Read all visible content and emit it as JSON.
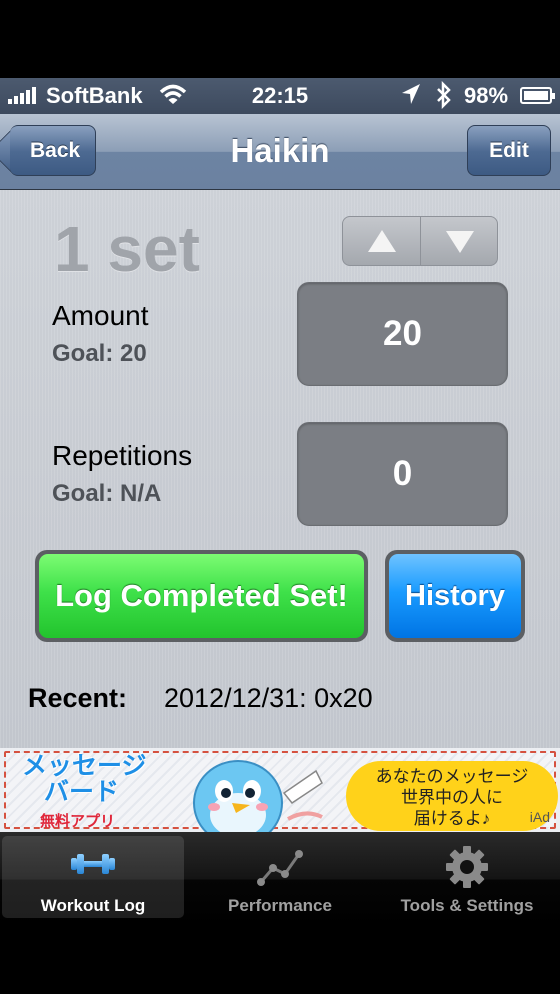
{
  "status_bar": {
    "carrier": "SoftBank",
    "time": "22:15",
    "battery": "98%"
  },
  "nav": {
    "back_label": "Back",
    "title": "Haikin",
    "edit_label": "Edit"
  },
  "workout": {
    "set_label": "1 set",
    "amount_label": "Amount",
    "amount_goal": "Goal: 20",
    "amount_value": "20",
    "reps_label": "Repetitions",
    "reps_goal": "Goal: N/A",
    "reps_value": "0",
    "log_button": "Log Completed Set!",
    "history_button": "History",
    "recent_label": "Recent:",
    "recent_value": "2012/12/31: 0x20"
  },
  "ad": {
    "title_line1": "メッセージ",
    "title_line2": "バード",
    "free_label": "無料アプリ",
    "bubble_line1": "あなたのメッセージ",
    "bubble_line2": "世界中の人に",
    "bubble_line3": "届けるよ♪",
    "iad": "iAd"
  },
  "tabs": [
    {
      "label": "Workout Log",
      "icon": "dumbbell-icon",
      "active": true
    },
    {
      "label": "Performance",
      "icon": "graph-icon",
      "active": false
    },
    {
      "label": "Tools & Settings",
      "icon": "gear-icon",
      "active": false
    }
  ],
  "colors": {
    "nav_bar": "#7b8fab",
    "log_button": "#33d63d",
    "history_button": "#1a93f5",
    "active_tab_icon": "#4aa3e8"
  }
}
